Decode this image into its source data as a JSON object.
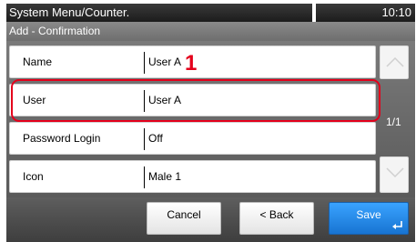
{
  "header": {
    "title": "System Menu/Counter.",
    "time": "10:10"
  },
  "subheader": {
    "title": "Add - Confirmation"
  },
  "rows": [
    {
      "label": "Name",
      "value": "User A"
    },
    {
      "label": "User",
      "value": "User A"
    },
    {
      "label": "Password Login",
      "value": "Off"
    },
    {
      "label": "Icon",
      "value": "Male 1"
    }
  ],
  "callout": "1",
  "pagination": {
    "text": "1/1"
  },
  "footer": {
    "cancel": "Cancel",
    "back": "< Back",
    "save": "Save"
  },
  "colors": {
    "highlight": "#e4001b",
    "save_button": "#1f7fe0",
    "header_bar": "#262626"
  },
  "icons": [
    "chevron-up-icon",
    "chevron-down-icon",
    "enter-icon"
  ]
}
